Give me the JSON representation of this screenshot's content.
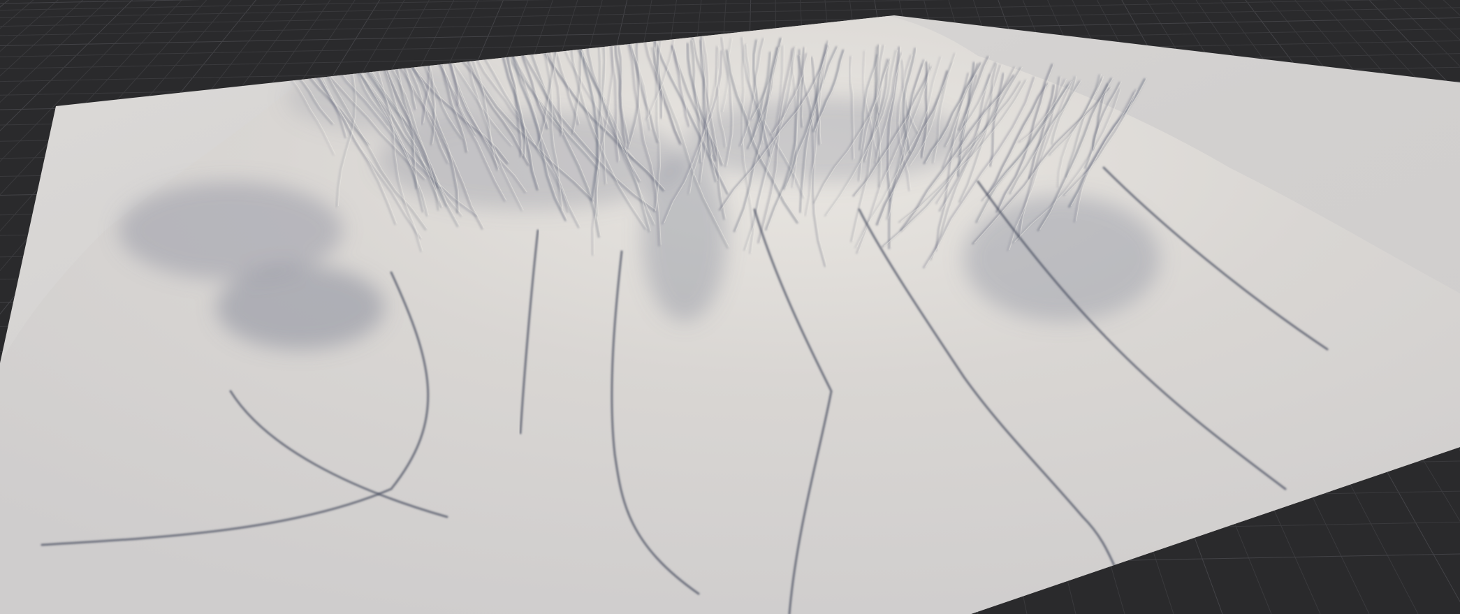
{
  "viewport": {
    "background_color": "#2a2a2c",
    "grid_line_color": "#3a3a3d",
    "grid_major_line_color": "#434347"
  },
  "terrain": {
    "base_color": "#d6d4d2",
    "light_color": "#eeebe6",
    "shadow_color": "#6f7384",
    "valley_color": "#4d5364",
    "warm_highlight_color": "#c9b79f"
  }
}
